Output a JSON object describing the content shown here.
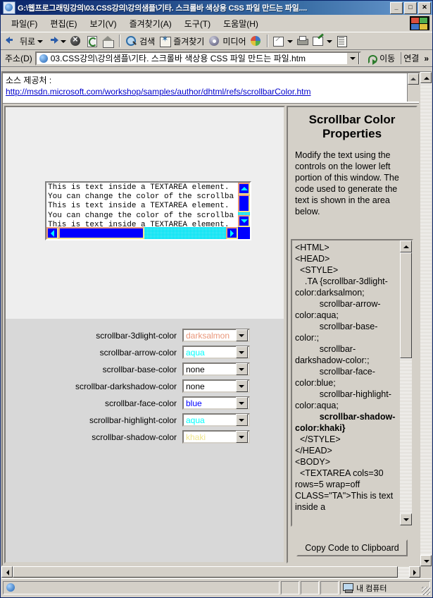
{
  "window": {
    "title": "G:\\웹프로그래밍강의\\03.CSS강의\\강의샘플\\기타. 스크롤바 색상용 CSS 파일 만드는 파일....",
    "minimize_label": "_",
    "maximize_label": "□",
    "close_label": "✕"
  },
  "menu": [
    {
      "label": "파일(F)"
    },
    {
      "label": "편집(E)"
    },
    {
      "label": "보기(V)"
    },
    {
      "label": "즐겨찾기(A)"
    },
    {
      "label": "도구(T)"
    },
    {
      "label": "도움말(H)"
    }
  ],
  "toolbar": {
    "back": "뒤로",
    "forward": "",
    "stop": "",
    "refresh": "",
    "home": "",
    "search": "검색",
    "favorites": "즐겨찾기",
    "media": "미디어",
    "history": "",
    "mail": "",
    "print": "",
    "edit": "",
    "discuss": ""
  },
  "address": {
    "label": "주소(D)",
    "value": "03.CSS강의\\강의샘플\\기타. 스크롤바 색상용 CSS 파일 만드는 파일.htm",
    "go_label": "이동",
    "links_label": "연결",
    "chevron": "»"
  },
  "source": {
    "label": "소스 제공처 :",
    "url": "http://msdn.microsoft.com/workshop/samples/author/dhtml/refs/scrollbarColor.htm"
  },
  "textarea": {
    "content": "This is text inside a TEXTAREA element.\nYou can change the color of the scrollba\nThis is text inside a TEXTAREA element.\nYou can change the color of the scrollba\nThis is text inside a TEXTAREA element."
  },
  "controls": [
    {
      "label": "scrollbar-3dlight-color",
      "value": "darksalmon",
      "color": "#e9967a"
    },
    {
      "label": "scrollbar-arrow-color",
      "value": "aqua",
      "color": "#00ffff"
    },
    {
      "label": "scrollbar-base-color",
      "value": "none",
      "color": "#000000"
    },
    {
      "label": "scrollbar-darkshadow-color",
      "value": "none",
      "color": "#000000"
    },
    {
      "label": "scrollbar-face-color",
      "value": "blue",
      "color": "#0000ff"
    },
    {
      "label": "scrollbar-highlight-color",
      "value": "aqua",
      "color": "#00ffff"
    },
    {
      "label": "scrollbar-shadow-color",
      "value": "khaki",
      "color": "#f0e68c"
    }
  ],
  "panel": {
    "title": "Scrollbar Color Properties",
    "description": "Modify the text using the controls on the lower left portion of this window. The code used to generate the text is shown in the area below.",
    "code_before": "<HTML>\n<HEAD>\n  <STYLE>\n    .TA {scrollbar-3dlight-color:darksalmon;\n          scrollbar-arrow-color:aqua;\n          scrollbar-base-color:;\n          scrollbar-darkshadow-color:;\n          scrollbar-face-color:blue;\n          scrollbar-highlight-color:aqua;\n          ",
    "code_highlight": "scrollbar-shadow-color:khaki}",
    "code_after": "\n  </STYLE>\n</HEAD>\n<BODY>\n  <TEXTAREA cols=30 rows=5 wrap=off CLASS=\"TA\">This is text inside a",
    "copy_button": "Copy Code to Clipboard"
  },
  "statusbar": {
    "message": "",
    "zone": "내 컴퓨터"
  }
}
